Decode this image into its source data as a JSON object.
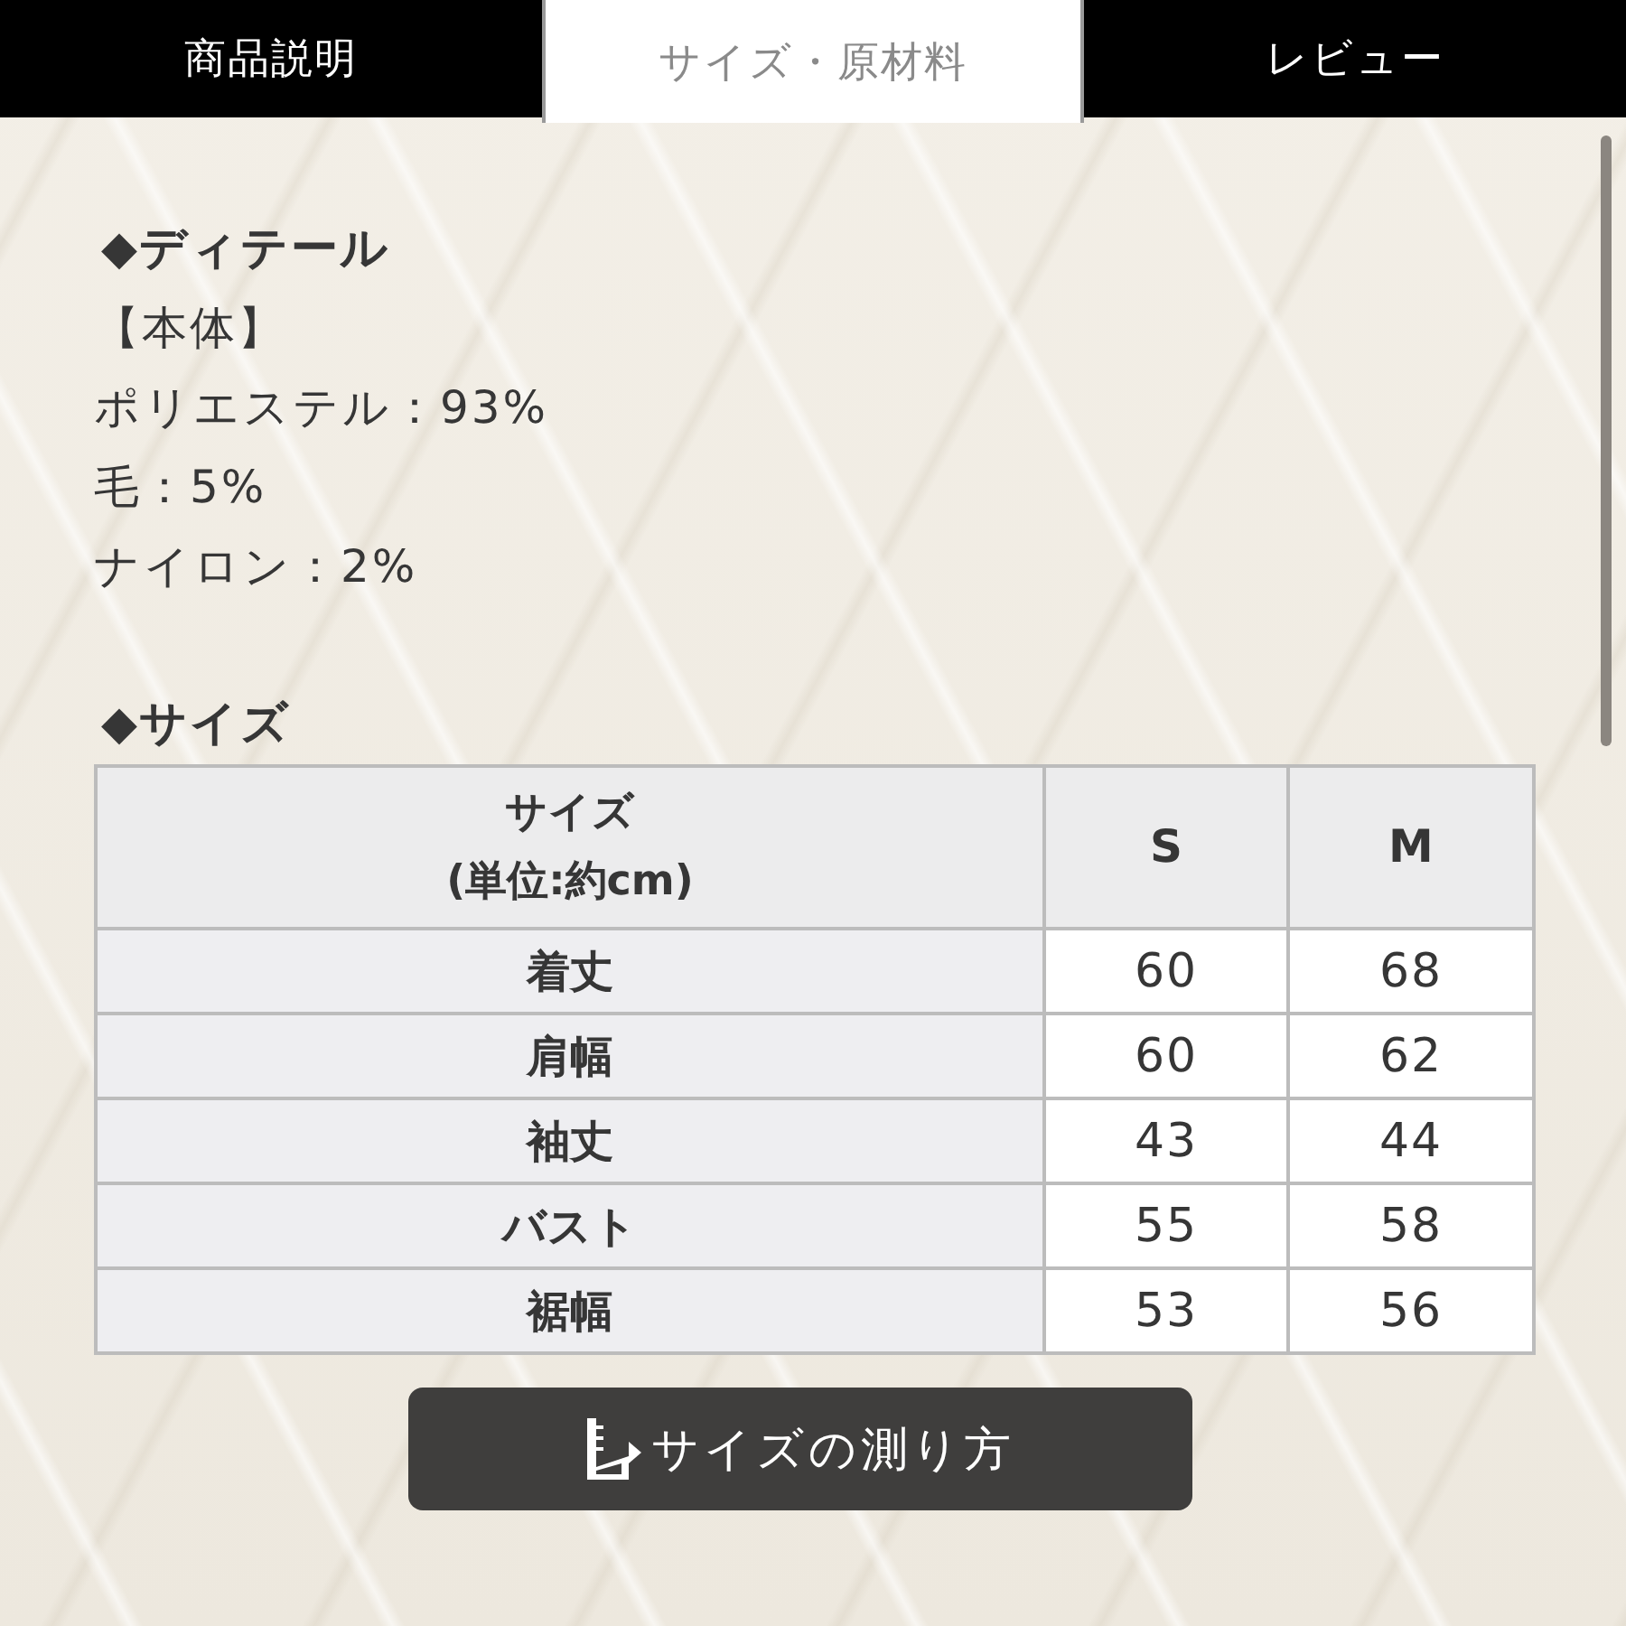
{
  "tabs": [
    {
      "label": "商品説明",
      "selected": false
    },
    {
      "label": "サイズ・原材料",
      "selected": true
    },
    {
      "label": "レビュー",
      "selected": false
    }
  ],
  "details": {
    "heading": "◆ディテール",
    "lines": [
      "【本体】",
      "ポリエステル：93%",
      "毛：5%",
      "ナイロン：2%"
    ]
  },
  "sizes": {
    "heading": "◆サイズ",
    "table": {
      "columns": [
        "サイズ\n(単位:約cm)",
        "S",
        "M"
      ],
      "rows": [
        {
          "label": "着丈",
          "values": [
            "60",
            "68"
          ]
        },
        {
          "label": "肩幅",
          "values": [
            "60",
            "62"
          ]
        },
        {
          "label": "袖丈",
          "values": [
            "43",
            "44"
          ]
        },
        {
          "label": "バスト",
          "values": [
            "55",
            "58"
          ]
        },
        {
          "label": "裾幅",
          "values": [
            "53",
            "56"
          ]
        }
      ]
    }
  },
  "measure_button": {
    "label": "サイズの測り方"
  }
}
